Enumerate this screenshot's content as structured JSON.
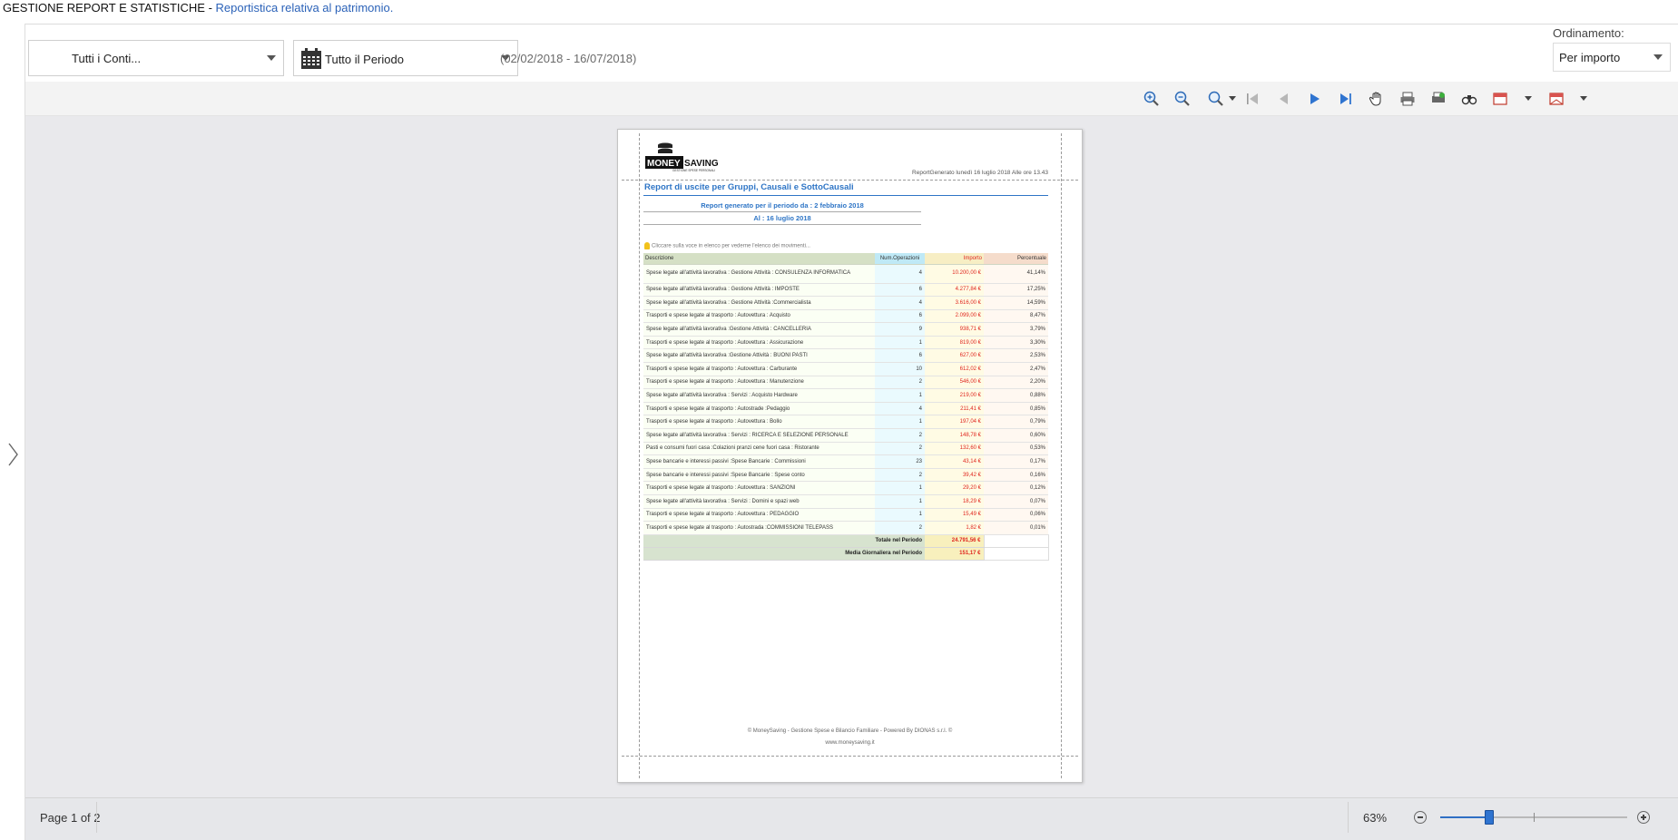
{
  "header": {
    "section_title": "GESTIONE REPORT E STATISTICHE",
    "separator": " - ",
    "subtitle": "Reportistica relativa al patrimonio."
  },
  "filters": {
    "accounts": "Tutti i Conti...",
    "period": "Tutto il Periodo",
    "date_range": "(02/02/2018 - 16/07/2018)",
    "sort_label": "Ordinamento:",
    "sort_value": "Per importo"
  },
  "toolbar": {
    "icons": [
      "zoom-in-icon",
      "zoom-out-icon",
      "zoom-menu-icon",
      "first-page-icon",
      "previous-page-icon",
      "next-page-icon",
      "last-page-icon",
      "hand-tool-icon",
      "print-icon",
      "page-setup-icon",
      "find-icon",
      "export-icon",
      "send-icon"
    ]
  },
  "report": {
    "generated_label": "ReportGenerato lunedì 16 luglio 2018 Alle ore 13.43",
    "title": "Report di uscite per Gruppi, Causali e SottoCausali",
    "period_from": "Report generato per il periodo da : 2 febbraio 2018",
    "period_to": "Al : 16 luglio 2018",
    "hint": "Cliccare sulla voce in elenco per vederne l'elenco dei movimenti...",
    "columns": [
      "Descrizione",
      "Num.Operazioni",
      "Importo",
      "Percentuale"
    ],
    "rows": [
      {
        "descrizione": "Spese legate all'attività lavorativa : Gestione Attività : CONSULENZA INFORMATICA",
        "num": "4",
        "importo": "10.200,00 €",
        "percentuale": "41,14%"
      },
      {
        "descrizione": "Spese legate all'attività lavorativa : Gestione Attività : IMPOSTE",
        "num": "6",
        "importo": "4.277,84 €",
        "percentuale": "17,25%"
      },
      {
        "descrizione": "Spese legate all'attività lavorativa : Gestione Attività :Commercialista",
        "num": "4",
        "importo": "3.616,00 €",
        "percentuale": "14,59%"
      },
      {
        "descrizione": "Trasporti e spese legate al trasporto : Autovettura : Acquisto",
        "num": "6",
        "importo": "2.099,00 €",
        "percentuale": "8,47%"
      },
      {
        "descrizione": "Spese legate all'attività lavorativa :Gestione Attività : CANCELLERIA",
        "num": "9",
        "importo": "938,71 €",
        "percentuale": "3,79%"
      },
      {
        "descrizione": "Trasporti e spese legate al trasporto : Autovettura : Assicurazione",
        "num": "1",
        "importo": "819,00 €",
        "percentuale": "3,30%"
      },
      {
        "descrizione": "Spese legate all'attività lavorativa :Gestione Attività : BUONI PASTI",
        "num": "6",
        "importo": "627,00 €",
        "percentuale": "2,53%"
      },
      {
        "descrizione": "Trasporti e spese legate al trasporto : Autovettura : Carburante",
        "num": "10",
        "importo": "612,02 €",
        "percentuale": "2,47%"
      },
      {
        "descrizione": "Trasporti e spese legate al trasporto : Autovettura : Manutenzione",
        "num": "2",
        "importo": "546,00 €",
        "percentuale": "2,20%"
      },
      {
        "descrizione": "Spese legate all'attività lavorativa : Servizi : Acquisto Hardware",
        "num": "1",
        "importo": "219,00 €",
        "percentuale": "0,88%"
      },
      {
        "descrizione": "Trasporti e spese legate al trasporto : Autostrade :Pedaggio",
        "num": "4",
        "importo": "211,41 €",
        "percentuale": "0,85%"
      },
      {
        "descrizione": "Trasporti e spese legate al trasporto : Autovettura : Bollo",
        "num": "1",
        "importo": "197,04 €",
        "percentuale": "0,79%"
      },
      {
        "descrizione": "Spese legate all'attività lavorativa : Servizi : RICERCA E SELEZIONE PERSONALE",
        "num": "2",
        "importo": "148,78 €",
        "percentuale": "0,60%"
      },
      {
        "descrizione": "Pasti e consumi fuori casa :Colazioni pranzi cene fuori casa : Ristorante",
        "num": "2",
        "importo": "132,60 €",
        "percentuale": "0,53%"
      },
      {
        "descrizione": "Spese bancarie e interessi passivi :Spese Bancarie : Commissioni",
        "num": "23",
        "importo": "43,14 €",
        "percentuale": "0,17%"
      },
      {
        "descrizione": "Spese bancarie e interessi passivi :Spese Bancarie : Spese conto",
        "num": "2",
        "importo": "39,42 €",
        "percentuale": "0,16%"
      },
      {
        "descrizione": "Trasporti e spese legate al trasporto : Autovettura : SANZIONI",
        "num": "1",
        "importo": "29,20 €",
        "percentuale": "0,12%"
      },
      {
        "descrizione": "Spese legate all'attività lavorativa : Servizi : Domini e spazi web",
        "num": "1",
        "importo": "18,29 €",
        "percentuale": "0,07%"
      },
      {
        "descrizione": "Trasporti e spese legate al trasporto : Autovettura : PEDAGGIO",
        "num": "1",
        "importo": "15,49 €",
        "percentuale": "0,06%"
      },
      {
        "descrizione": "Trasporti e spese legate al trasporto : Autostrada :COMMISSIONI TELEPASS",
        "num": "2",
        "importo": "1,82 €",
        "percentuale": "0,01%"
      }
    ],
    "total_label": "Totale nel Periodo",
    "total_value": "24.791,56 €",
    "avg_label": "Media Giornaliera nel Periodo",
    "avg_value": "151,17 €",
    "footer_line1": "© MoneySaving - Gestione Spese e Bilancio Familiare - Powered By DIONAS s.r.l. ©",
    "footer_line2": "www.moneysaving.it",
    "logo_text": "MONEY SAVING",
    "logo_tagline": "GESTIONE SPESE PERSONALI"
  },
  "status": {
    "page_indicator": "Page 1 of 2",
    "zoom_label": "63%",
    "zoom_percent": 63,
    "zoom_slider_fraction": 0.26
  },
  "colors": {
    "accent_blue": "#2e75c6",
    "amount_red": "#e0261e",
    "slider_blue": "#2f74d0"
  }
}
